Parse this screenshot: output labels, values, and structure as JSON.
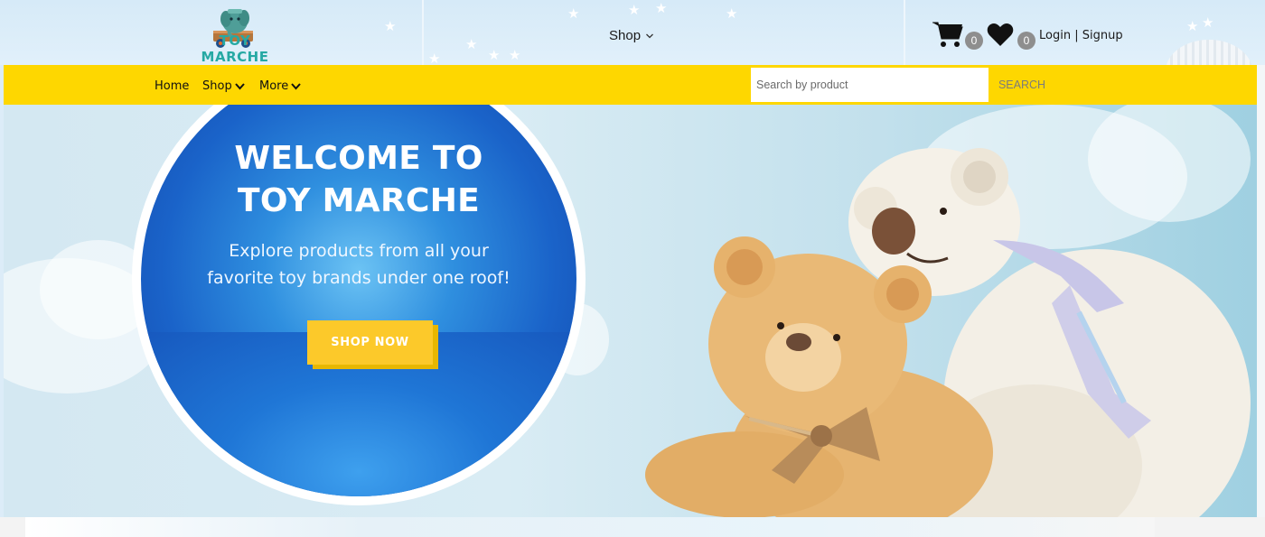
{
  "header": {
    "logo_text": "TOY MARCHE",
    "shop_label": "Shop",
    "cart_count": "0",
    "wishlist_count": "0",
    "login_label": "Login",
    "auth_separator": " | ",
    "signup_label": "Signup"
  },
  "nav": {
    "items": [
      {
        "label": "Home"
      },
      {
        "label": "Shop"
      },
      {
        "label": "More"
      }
    ],
    "search_placeholder": "Search by product",
    "search_button": "SEARCH"
  },
  "hero": {
    "title_line1": "WELCOME TO",
    "title_line2": "TOY MARCHE",
    "subtitle_line1": "Explore products from all your",
    "subtitle_line2": "favorite toy brands under one roof!",
    "cta_label": "SHOP NOW"
  },
  "colors": {
    "nav_background": "#fed700",
    "hero_circle": "#1a63c9",
    "cta": "#fcc92a",
    "badge": "#8e8e8e"
  },
  "icons": {
    "cart": "shopping-cart-icon",
    "wishlist": "heart-icon",
    "dropdown": "chevron-down-icon"
  }
}
